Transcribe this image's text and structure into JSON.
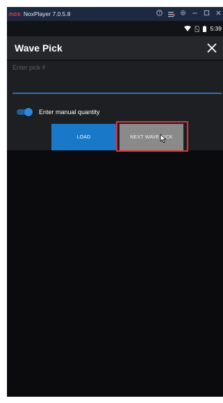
{
  "emulator": {
    "logo": "nox",
    "title": "NoxPlayer 7.0.5.8"
  },
  "status_bar": {
    "time": "5:39"
  },
  "app_bar": {
    "title": "Wave Pick"
  },
  "form": {
    "pick_input": {
      "placeholder": "Enter pick #",
      "value": ""
    },
    "manual_quantity": {
      "label": "Enter manual quantity",
      "enabled": true
    },
    "buttons": {
      "load_label": "LOAD",
      "next_label": "NEXT WAVE PICK"
    }
  },
  "colors": {
    "accent": "#1a78c9",
    "highlight": "#e0303a",
    "background": "#0b0b0d"
  }
}
